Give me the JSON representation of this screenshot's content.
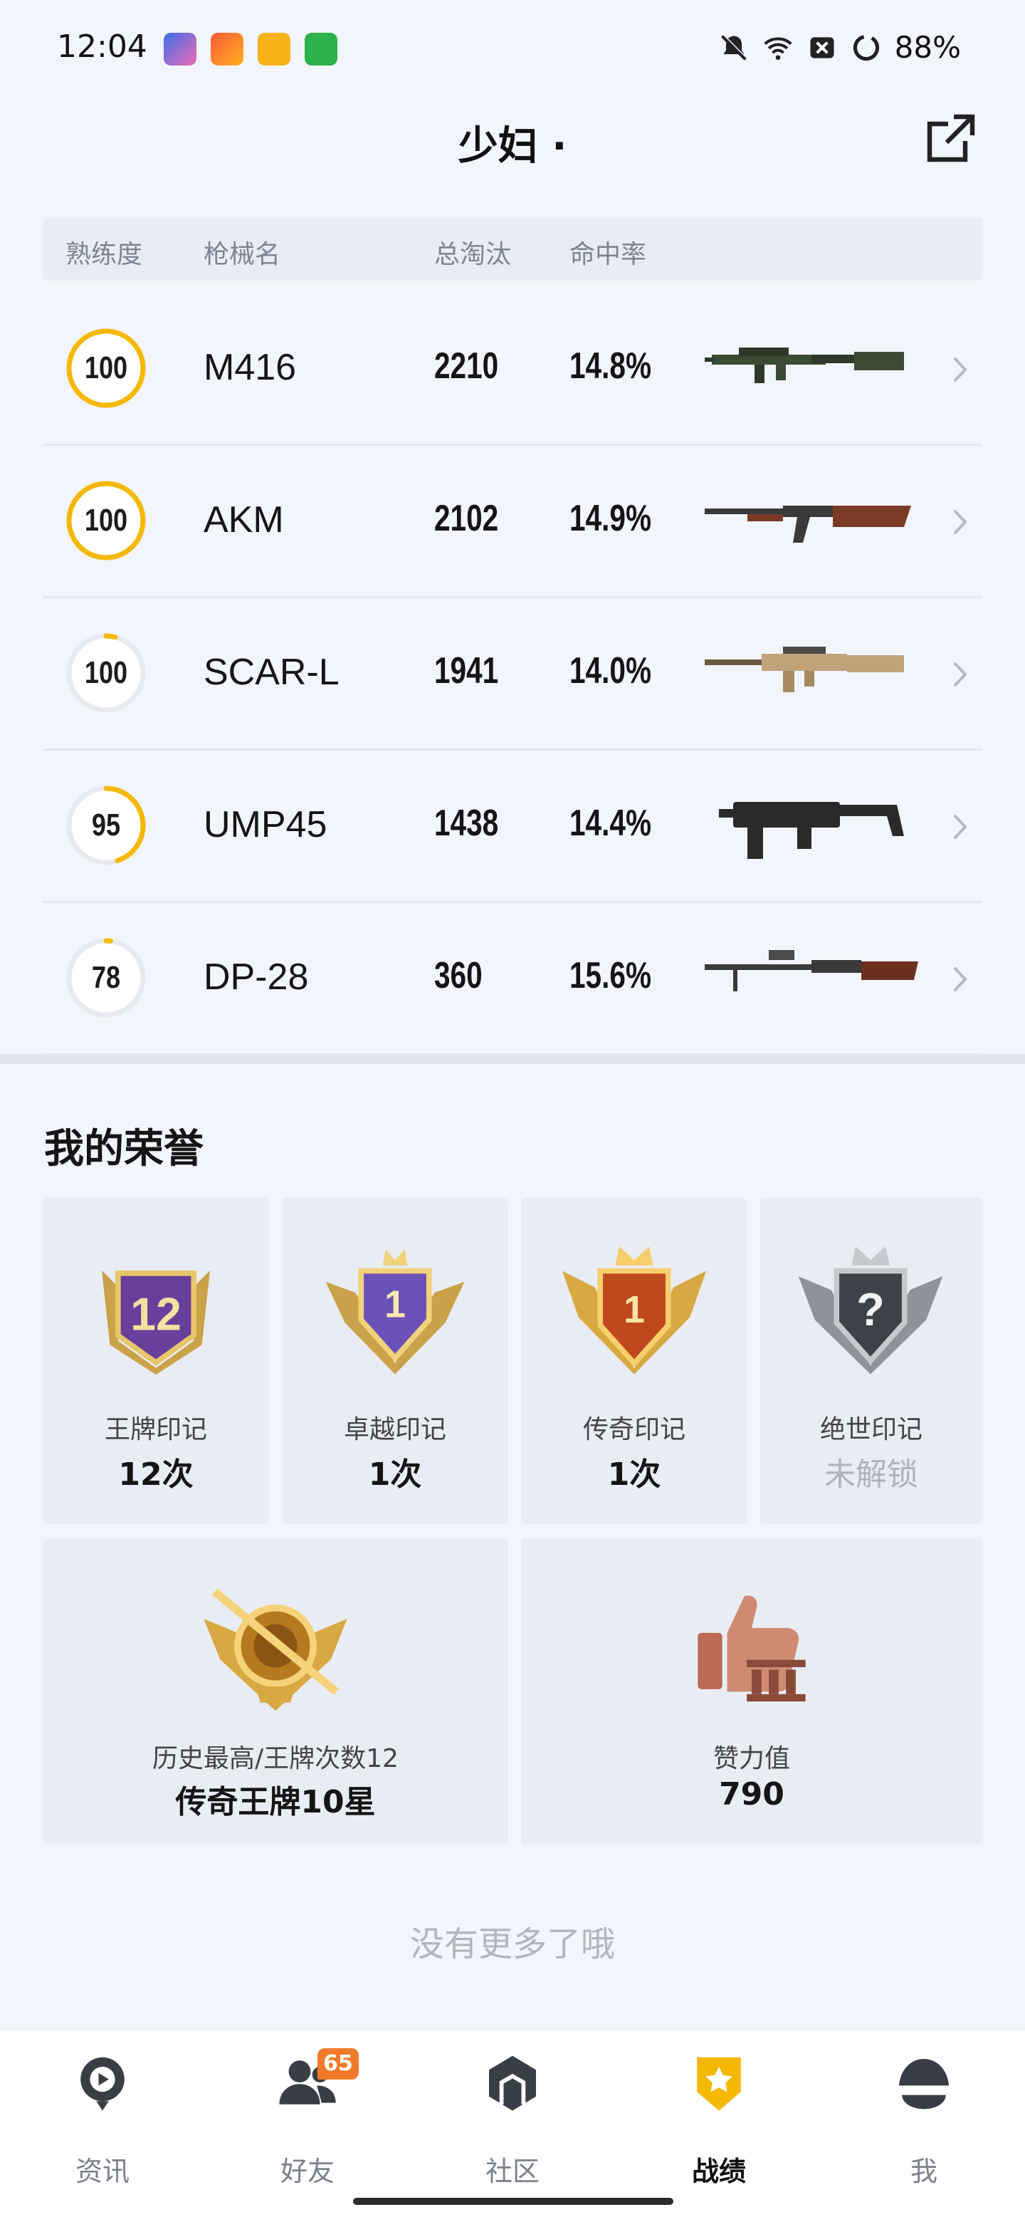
{
  "status_bar": {
    "time": "12:04",
    "battery": "88%",
    "icons": [
      "mute-bell-icon",
      "wifi-icon",
      "sim-off-icon",
      "battery-ring-icon"
    ]
  },
  "header": {
    "title": "少妇 ·",
    "share_icon": "share-external-icon"
  },
  "weapons_table": {
    "columns": [
      "熟练度",
      "枪械名",
      "总淘汰",
      "命中率"
    ],
    "rows": [
      {
        "mastery": "100",
        "progress": 1.0,
        "name": "M416",
        "eliminations": "2210",
        "hit_rate": "14.8%"
      },
      {
        "mastery": "100",
        "progress": 1.0,
        "name": "AKM",
        "eliminations": "2102",
        "hit_rate": "14.9%"
      },
      {
        "mastery": "100",
        "progress": 0.04,
        "name": "SCAR-L",
        "eliminations": "1941",
        "hit_rate": "14.0%"
      },
      {
        "mastery": "95",
        "progress": 0.45,
        "name": "UMP45",
        "eliminations": "1438",
        "hit_rate": "14.4%"
      },
      {
        "mastery": "78",
        "progress": 0.02,
        "name": "DP-28",
        "eliminations": "360",
        "hit_rate": "15.6%"
      }
    ]
  },
  "honors": {
    "title": "我的荣誉",
    "cards": [
      {
        "label": "王牌印记",
        "value": "12次",
        "badge_text": "12"
      },
      {
        "label": "卓越印记",
        "value": "1次",
        "badge_text": "1"
      },
      {
        "label": "传奇印记",
        "value": "1次",
        "badge_text": "1"
      },
      {
        "label": "绝世印记",
        "value": "未解锁",
        "badge_text": "?"
      }
    ],
    "wide_cards": [
      {
        "label": "历史最高/王牌次数12",
        "value": "传奇王牌10星"
      },
      {
        "label": "赞力值",
        "value": "790"
      }
    ]
  },
  "footer_text": "没有更多了哦",
  "tabbar": {
    "tabs": [
      {
        "label": "资讯",
        "icon": "news-play-icon"
      },
      {
        "label": "好友",
        "icon": "friends-icon",
        "badge": "65"
      },
      {
        "label": "社区",
        "icon": "community-icon"
      },
      {
        "label": "战绩",
        "icon": "record-badge-icon",
        "active": true
      },
      {
        "label": "我",
        "icon": "helmet-icon"
      }
    ]
  },
  "colors": {
    "accent": "#f5b800",
    "background": "#f2f5fb",
    "ring_track": "#e6e9ee",
    "badge_orange": "#f07a2a"
  }
}
